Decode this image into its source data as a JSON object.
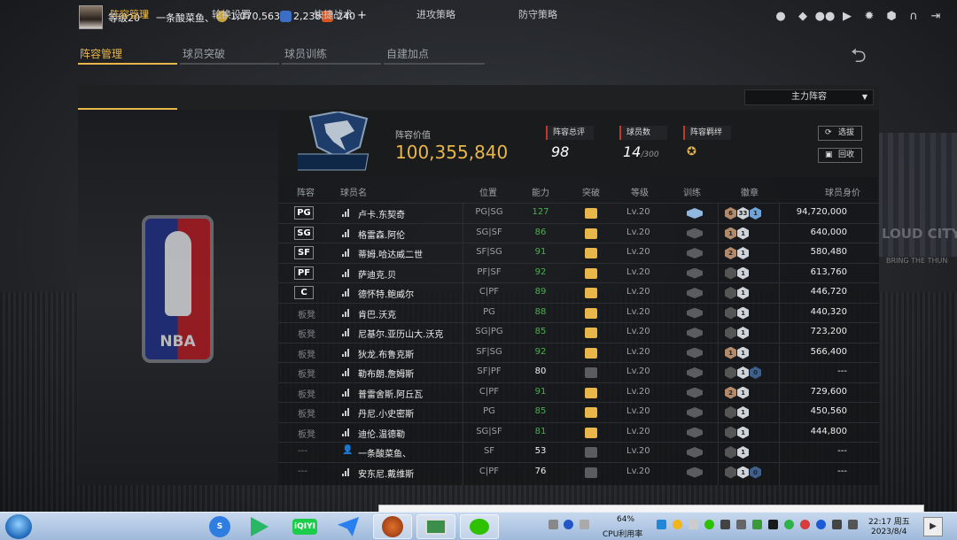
{
  "user": {
    "level": "等级20",
    "name": "一条酸菜鱼、",
    "coins": "1,070,563",
    "stars": "2,238",
    "tickets": "240",
    "plus": "+"
  },
  "top_tabs": [
    {
      "label": "阵容管理",
      "active": true
    },
    {
      "label": "球员突破",
      "active": false
    },
    {
      "label": "球员训练",
      "active": false
    },
    {
      "label": "自建加点",
      "active": false
    }
  ],
  "sub_tabs": [
    {
      "label": "阵容管理",
      "active": true
    },
    {
      "label": "轮换设置",
      "active": false
    },
    {
      "label": "快捷战术",
      "active": false
    },
    {
      "label": "进攻策略",
      "active": false
    },
    {
      "label": "防守策略",
      "active": false
    }
  ],
  "lineup_select": "主力阵容",
  "team": {
    "logo_text": "MAVERICKS",
    "value_label": "阵容价值",
    "value": "100,355,840",
    "total_rating_label": "阵容总评",
    "total_rating": "98",
    "player_count_label": "球员数",
    "player_count": "14",
    "player_max": "/300",
    "bond_label": "阵容羁绊",
    "btn_pick": "选拔",
    "btn_recycle": "回收"
  },
  "columns": [
    "阵容",
    "球员名",
    "位置",
    "能力",
    "突破",
    "等级",
    "训练",
    "徽章",
    "球员身价"
  ],
  "players": [
    {
      "slot": "PG",
      "starter": true,
      "icon": "signal",
      "name": "卢卡.东契奇",
      "pos": "PG|SG",
      "rating": "127",
      "rating_color": "#4caf50",
      "breakthrough": "gold",
      "level": "Lv.20",
      "train": "blue",
      "badges": [
        {
          "c": "#b08a6a",
          "t": "6"
        },
        {
          "c": "#cfd4da",
          "t": "33"
        },
        {
          "c": "#6fa3d6",
          "t": "1"
        }
      ],
      "value": "94,720,000"
    },
    {
      "slot": "SG",
      "starter": true,
      "icon": "signal",
      "name": "格雷森.阿伦",
      "pos": "SG|SF",
      "rating": "86",
      "rating_color": "#4caf50",
      "breakthrough": "gold",
      "level": "Lv.20",
      "train": "grey",
      "badges": [
        {
          "c": "#b08a6a",
          "t": "1"
        },
        {
          "c": "#cfd4da",
          "t": "1"
        }
      ],
      "value": "640,000"
    },
    {
      "slot": "SF",
      "starter": true,
      "icon": "signal",
      "name": "蒂姆.哈达威二世",
      "pos": "SF|SG",
      "rating": "91",
      "rating_color": "#4caf50",
      "breakthrough": "gold",
      "level": "Lv.20",
      "train": "grey",
      "badges": [
        {
          "c": "#b08a6a",
          "t": "2"
        },
        {
          "c": "#cfd4da",
          "t": "1"
        }
      ],
      "value": "580,480"
    },
    {
      "slot": "PF",
      "starter": true,
      "icon": "signal",
      "name": "萨迪克.贝",
      "pos": "PF|SF",
      "rating": "92",
      "rating_color": "#4caf50",
      "breakthrough": "gold",
      "level": "Lv.20",
      "train": "grey",
      "badges": [
        {
          "c": "#555",
          "t": ""
        },
        {
          "c": "#cfd4da",
          "t": "1"
        }
      ],
      "value": "613,760"
    },
    {
      "slot": "C",
      "starter": true,
      "icon": "signal",
      "name": "德怀特.鲍威尔",
      "pos": "C|PF",
      "rating": "89",
      "rating_color": "#4caf50",
      "breakthrough": "gold",
      "level": "Lv.20",
      "train": "grey",
      "badges": [
        {
          "c": "#555",
          "t": ""
        },
        {
          "c": "#cfd4da",
          "t": "1"
        }
      ],
      "value": "446,720"
    },
    {
      "slot": "板凳",
      "starter": false,
      "icon": "signal",
      "name": "肯巴.沃克",
      "pos": "PG",
      "rating": "88",
      "rating_color": "#4caf50",
      "breakthrough": "gold",
      "level": "Lv.20",
      "train": "grey",
      "badges": [
        {
          "c": "#555",
          "t": ""
        },
        {
          "c": "#cfd4da",
          "t": "1"
        }
      ],
      "value": "440,320"
    },
    {
      "slot": "板凳",
      "starter": false,
      "icon": "signal",
      "name": "尼基尔.亚历山大.沃克",
      "pos": "SG|PG",
      "rating": "85",
      "rating_color": "#4caf50",
      "breakthrough": "gold",
      "level": "Lv.20",
      "train": "grey",
      "badges": [
        {
          "c": "#555",
          "t": ""
        },
        {
          "c": "#cfd4da",
          "t": "1"
        }
      ],
      "value": "723,200"
    },
    {
      "slot": "板凳",
      "starter": false,
      "icon": "signal",
      "name": "狄龙.布鲁克斯",
      "pos": "SF|SG",
      "rating": "92",
      "rating_color": "#4caf50",
      "breakthrough": "gold",
      "level": "Lv.20",
      "train": "grey",
      "badges": [
        {
          "c": "#b08a6a",
          "t": "1"
        },
        {
          "c": "#cfd4da",
          "t": "1"
        }
      ],
      "value": "566,400"
    },
    {
      "slot": "板凳",
      "starter": false,
      "icon": "signal",
      "name": "勒布朗.詹姆斯",
      "pos": "SF|PF",
      "rating": "80",
      "rating_color": "#eeeeee",
      "breakthrough": "grey",
      "level": "Lv.20",
      "train": "grey",
      "badges": [
        {
          "c": "#555",
          "t": ""
        },
        {
          "c": "#cfd4da",
          "t": "1"
        },
        {
          "c": "#3d5f8a",
          "t": "0"
        }
      ],
      "value": "---"
    },
    {
      "slot": "板凳",
      "starter": false,
      "icon": "signal",
      "name": "普雷舍斯.阿丘瓦",
      "pos": "C|PF",
      "rating": "91",
      "rating_color": "#4caf50",
      "breakthrough": "gold",
      "level": "Lv.20",
      "train": "grey",
      "badges": [
        {
          "c": "#b08a6a",
          "t": "2"
        },
        {
          "c": "#cfd4da",
          "t": "1"
        }
      ],
      "value": "729,600"
    },
    {
      "slot": "板凳",
      "starter": false,
      "icon": "signal",
      "name": "丹尼.小史密斯",
      "pos": "PG",
      "rating": "85",
      "rating_color": "#4caf50",
      "breakthrough": "gold",
      "level": "Lv.20",
      "train": "grey",
      "badges": [
        {
          "c": "#555",
          "t": ""
        },
        {
          "c": "#cfd4da",
          "t": "1"
        }
      ],
      "value": "450,560"
    },
    {
      "slot": "板凳",
      "starter": false,
      "icon": "signal",
      "name": "迪伦.温德勒",
      "pos": "SG|SF",
      "rating": "81",
      "rating_color": "#4caf50",
      "breakthrough": "gold",
      "level": "Lv.20",
      "train": "grey",
      "badges": [
        {
          "c": "#555",
          "t": ""
        },
        {
          "c": "#cfd4da",
          "t": "1"
        }
      ],
      "value": "444,800"
    },
    {
      "slot": "---",
      "starter": false,
      "icon": "person",
      "name": "一条酸菜鱼、",
      "pos": "SF",
      "rating": "53",
      "rating_color": "#eeeeee",
      "breakthrough": "grey",
      "level": "Lv.20",
      "train": "grey",
      "badges": [
        {
          "c": "#555",
          "t": ""
        },
        {
          "c": "#cfd4da",
          "t": "1"
        }
      ],
      "value": "---"
    },
    {
      "slot": "---",
      "starter": false,
      "icon": "signal",
      "name": "安东尼.戴维斯",
      "pos": "C|PF",
      "rating": "76",
      "rating_color": "#eeeeee",
      "breakthrough": "grey",
      "level": "Lv.20",
      "train": "grey",
      "badges": [
        {
          "c": "#555",
          "t": ""
        },
        {
          "c": "#cfd4da",
          "t": "1"
        },
        {
          "c": "#3d5f8a",
          "t": "0"
        }
      ],
      "value": "---"
    }
  ],
  "background": {
    "city_text": "LOUD CITY",
    "city_sub": "BRING THE THUN"
  },
  "taskbar": {
    "apps": [
      "sogou",
      "player",
      "iQIYI",
      "feishu",
      "nba2k",
      "monitor",
      "wechat"
    ],
    "cpu_percent": "64%",
    "cpu_label": "CPU利用率",
    "time": "22:17 周五",
    "date": "2023/8/4"
  }
}
